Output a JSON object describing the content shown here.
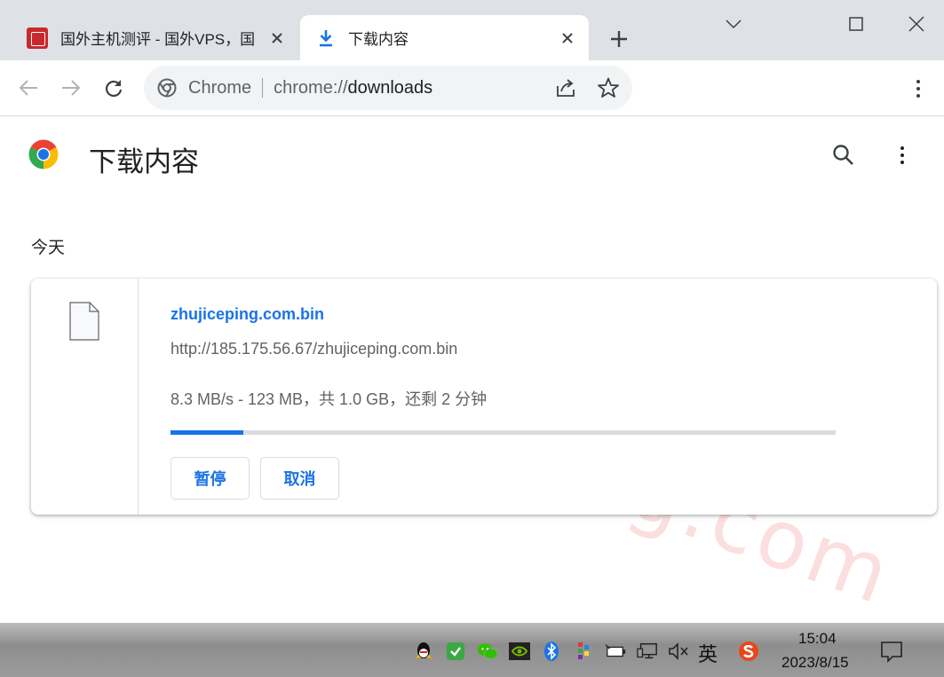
{
  "tabs": [
    {
      "title": "国外主机测评 - 国外VPS，国",
      "active": false
    },
    {
      "title": "下载内容",
      "active": true
    }
  ],
  "omnibox": {
    "site": "Chrome",
    "url_scheme": "chrome://",
    "url_host": "downloads"
  },
  "page": {
    "title": "下载内容",
    "section_date": "今天"
  },
  "download": {
    "file_name": "zhujiceping.com.bin",
    "url": "http://185.175.56.67/zhujiceping.com.bin",
    "status": "8.3 MB/s - 123 MB，共 1.0 GB，还剩 2 分钟",
    "progress_percent": 11,
    "pause_label": "暂停",
    "cancel_label": "取消"
  },
  "watermark": "zhujiceping.com",
  "taskbar": {
    "ime": "英",
    "time": "15:04",
    "date": "2023/8/15"
  },
  "colors": {
    "accent": "#1a73e8",
    "tabbar": "#dee1e6",
    "watermark": "#eb5050"
  }
}
